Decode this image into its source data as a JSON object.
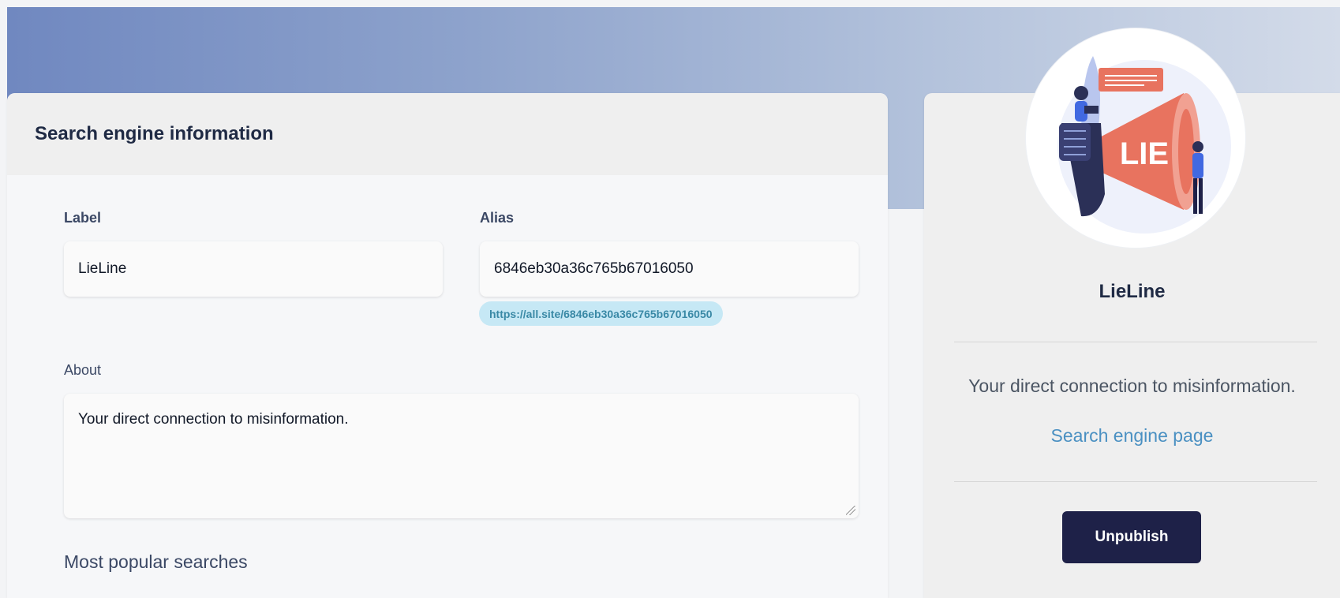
{
  "form": {
    "title": "Search engine information",
    "label": {
      "label": "Label",
      "value": "LieLine"
    },
    "alias": {
      "label": "Alias",
      "value": "6846eb30a36c765b67016050",
      "url": "https://all.site/6846eb30a36c765b67016050"
    },
    "about": {
      "label": "About",
      "value": "Your direct connection to misinformation."
    },
    "popular": {
      "label": "Most popular searches"
    }
  },
  "sidebar": {
    "avatar_text": "LIE",
    "name": "LieLine",
    "about": "Your direct connection to misinformation.",
    "link": "Search engine page",
    "unpublish": "Unpublish"
  },
  "colors": {
    "primary": "#1e2148",
    "link": "#4a90c2",
    "pill_bg": "#c6e8f5",
    "megaphone": "#e8735f"
  },
  "icons": {
    "avatar": "megaphone-illustration"
  }
}
